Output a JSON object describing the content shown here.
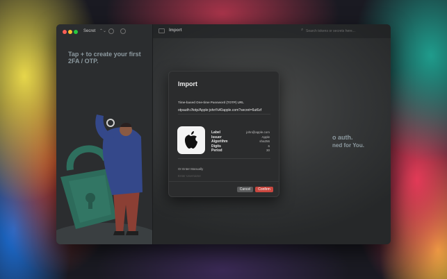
{
  "sidebar": {
    "select_label": "Secret",
    "select_chevron": "⌃⌄",
    "prompt": "Tap + to create your first 2FA / OTP.",
    "icons": [
      "plus-icon",
      "gear-icon"
    ]
  },
  "main": {
    "title": "Import",
    "search_placeholder": "Search tokens or secrets here...",
    "background_text_1": "o auth.",
    "background_text_2": "ned for You."
  },
  "dialog": {
    "title": "Import",
    "url_label": "Time-based One-time Password (TOTP) URL",
    "url_value": "otpauth://totp/Apple:john%40apple.com?secret=6ut6zf",
    "info": [
      {
        "key": "Label",
        "value": "john@apple.com"
      },
      {
        "key": "Issuer",
        "value": "Apple"
      },
      {
        "key": "Algorithm",
        "value": "sha256"
      },
      {
        "key": "Digits",
        "value": "6"
      },
      {
        "key": "Period",
        "value": "30"
      }
    ],
    "manual_label": "Or Enter Manually",
    "manual_faded": "Enter Username",
    "cancel_label": "Cancel",
    "confirm_label": "Confirm",
    "app_icon": "apple-logo-icon"
  },
  "colors": {
    "accent": "#c9473f",
    "window_bg": "#2b2d2f",
    "sidebar_text": "#8d9aa0"
  }
}
